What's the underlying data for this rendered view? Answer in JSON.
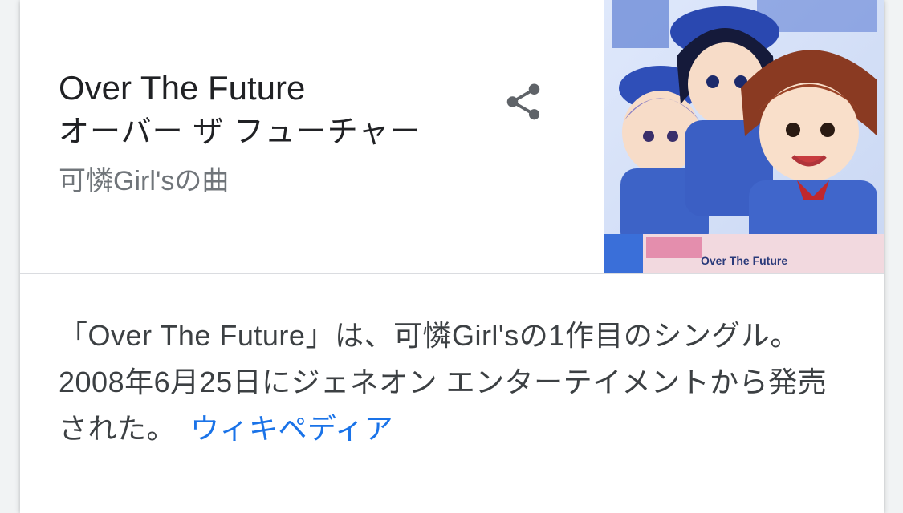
{
  "knowledge_panel": {
    "title": "Over The Future",
    "title_reading": "オーバー ザ フューチャー",
    "subtitle": "可憐Girl'sの曲",
    "share_icon": "share-icon",
    "thumbnail": {
      "caption": "Over The Future"
    },
    "description": "「Over The Future」は、可憐Girl'sの1作目のシングル。2008年6月25日にジェネオン エンターテイメントから発売された。",
    "source_link": "ウィキペディア"
  },
  "colors": {
    "title": "#202124",
    "meta": "#70757a",
    "body": "#3c4043",
    "link": "#1a73e8",
    "icon": "#5f6368"
  }
}
